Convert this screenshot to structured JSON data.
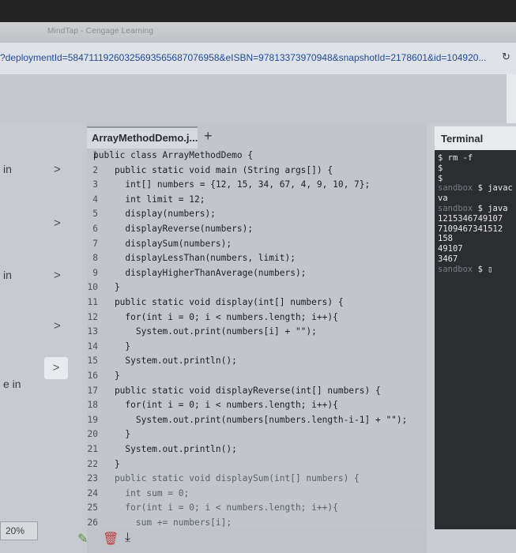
{
  "browser": {
    "tab_text": "MindTap - Cengage Learning",
    "url": "?deploymentId=58471119260325693565687076958&eISBN=97813373970948&snapshotId=2178601&id=104920..."
  },
  "sidebar": {
    "items": [
      {
        "label": "in",
        "chevron": ">"
      },
      {
        "label": "",
        "chevron": ">"
      },
      {
        "label": "in",
        "chevron": ">"
      },
      {
        "label": "",
        "chevron": ">"
      },
      {
        "label": "e in",
        "chevron": ""
      }
    ],
    "progress": "20%"
  },
  "editor": {
    "file_tab": "ArrayMethodDemo.j...",
    "add_tab": "+",
    "lines": [
      {
        "n": "1",
        "t": "public class ArrayMethodDemo {",
        "faint": false
      },
      {
        "n": "2",
        "t": "    public static void main (String args[]) {",
        "faint": false
      },
      {
        "n": "3",
        "t": "      int[] numbers = {12, 15, 34, 67, 4, 9, 10, 7};",
        "faint": false
      },
      {
        "n": "4",
        "t": "      int limit = 12;",
        "faint": false
      },
      {
        "n": "5",
        "t": "      display(numbers);",
        "faint": false
      },
      {
        "n": "6",
        "t": "      displayReverse(numbers);",
        "faint": false
      },
      {
        "n": "7",
        "t": "      displaySum(numbers);",
        "faint": false
      },
      {
        "n": "8",
        "t": "      displayLessThan(numbers, limit);",
        "faint": false
      },
      {
        "n": "9",
        "t": "      displayHigherThanAverage(numbers);",
        "faint": false
      },
      {
        "n": "10",
        "t": "    }",
        "faint": false
      },
      {
        "n": "11",
        "t": "    public static void display(int[] numbers) {",
        "faint": false
      },
      {
        "n": "12",
        "t": "      for(int i = 0; i < numbers.length; i++){",
        "faint": false
      },
      {
        "n": "13",
        "t": "        System.out.print(numbers[i] + \"\");",
        "faint": false
      },
      {
        "n": "14",
        "t": "      }",
        "faint": false
      },
      {
        "n": "15",
        "t": "      System.out.println();",
        "faint": false
      },
      {
        "n": "16",
        "t": "    }",
        "faint": false
      },
      {
        "n": "17",
        "t": "    public static void displayReverse(int[] numbers) {",
        "faint": false
      },
      {
        "n": "18",
        "t": "      for(int i = 0; i < numbers.length; i++){",
        "faint": false
      },
      {
        "n": "19",
        "t": "        System.out.print(numbers[numbers.length-i-1] + \"\");",
        "faint": false
      },
      {
        "n": "20",
        "t": "      }",
        "faint": false
      },
      {
        "n": "21",
        "t": "      System.out.println();",
        "faint": false
      },
      {
        "n": "22",
        "t": "    }",
        "faint": false
      },
      {
        "n": "23",
        "t": "    public static void displaySum(int[] numbers) {",
        "faint": true
      },
      {
        "n": "24",
        "t": "      int sum = 0;",
        "faint": true
      },
      {
        "n": "25",
        "t": "      for(int i = 0; i < numbers.length; i++){",
        "faint": true
      },
      {
        "n": "26",
        "t": "        sum += numbers[i];",
        "faint": true
      }
    ]
  },
  "terminal": {
    "title": "Terminal",
    "lines": [
      {
        "prompt": "",
        "text": "$ rm -f"
      },
      {
        "prompt": "",
        "text": "$"
      },
      {
        "prompt": "",
        "text": "$"
      },
      {
        "prompt": "sandbox",
        "text": " $ javac"
      },
      {
        "prompt": "",
        "text": "va"
      },
      {
        "prompt": "sandbox",
        "text": " $ java"
      },
      {
        "prompt": "",
        "text": "1215346749107"
      },
      {
        "prompt": "",
        "text": "7109467341512"
      },
      {
        "prompt": "",
        "text": "158"
      },
      {
        "prompt": "",
        "text": "49107"
      },
      {
        "prompt": "",
        "text": "3467"
      },
      {
        "prompt": "sandbox",
        "text": " $ ▯"
      }
    ]
  },
  "colors": {
    "accent": "#2b6cb0",
    "terminal_bg": "#2b2d30",
    "editor_bg": "#c2c6cb"
  }
}
